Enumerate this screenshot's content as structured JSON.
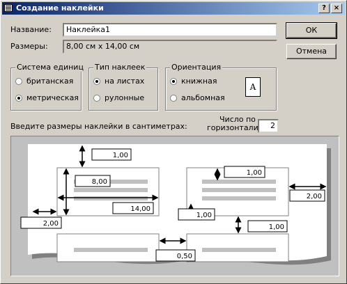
{
  "window": {
    "title": "Создание наклейки",
    "help": "?",
    "close": "×"
  },
  "name_label": "Название:",
  "name_value": "Наклейка1",
  "size_label": "Размеры:",
  "size_value": "8,00 см х 14,00 см",
  "ok_label": "ОК",
  "cancel_label": "Отмена",
  "units": {
    "title": "Система единиц",
    "options": [
      "британская",
      "метрическая"
    ],
    "selected": 1
  },
  "label_type": {
    "title": "Тип наклеек",
    "options": [
      "на листах",
      "рулонные"
    ],
    "selected": 0
  },
  "orientation": {
    "title": "Ориентация",
    "options": [
      "книжная",
      "альбомная"
    ],
    "selected": 0,
    "icon_letter": "A"
  },
  "instruction": "Введите размеры наклейки в сантиметрах:",
  "across_label_1": "Число по",
  "across_label_2": "горизонтали:",
  "across_value": "2",
  "preview_fields": {
    "top_margin": "1,00",
    "label_height": "8,00",
    "label_width": "14,00",
    "left_margin": "2,00",
    "inner_top": "1,00",
    "right_margin": "2,00",
    "inner_bottom": "1,00",
    "row_gap": "1,00",
    "col_gap": "0,50"
  }
}
